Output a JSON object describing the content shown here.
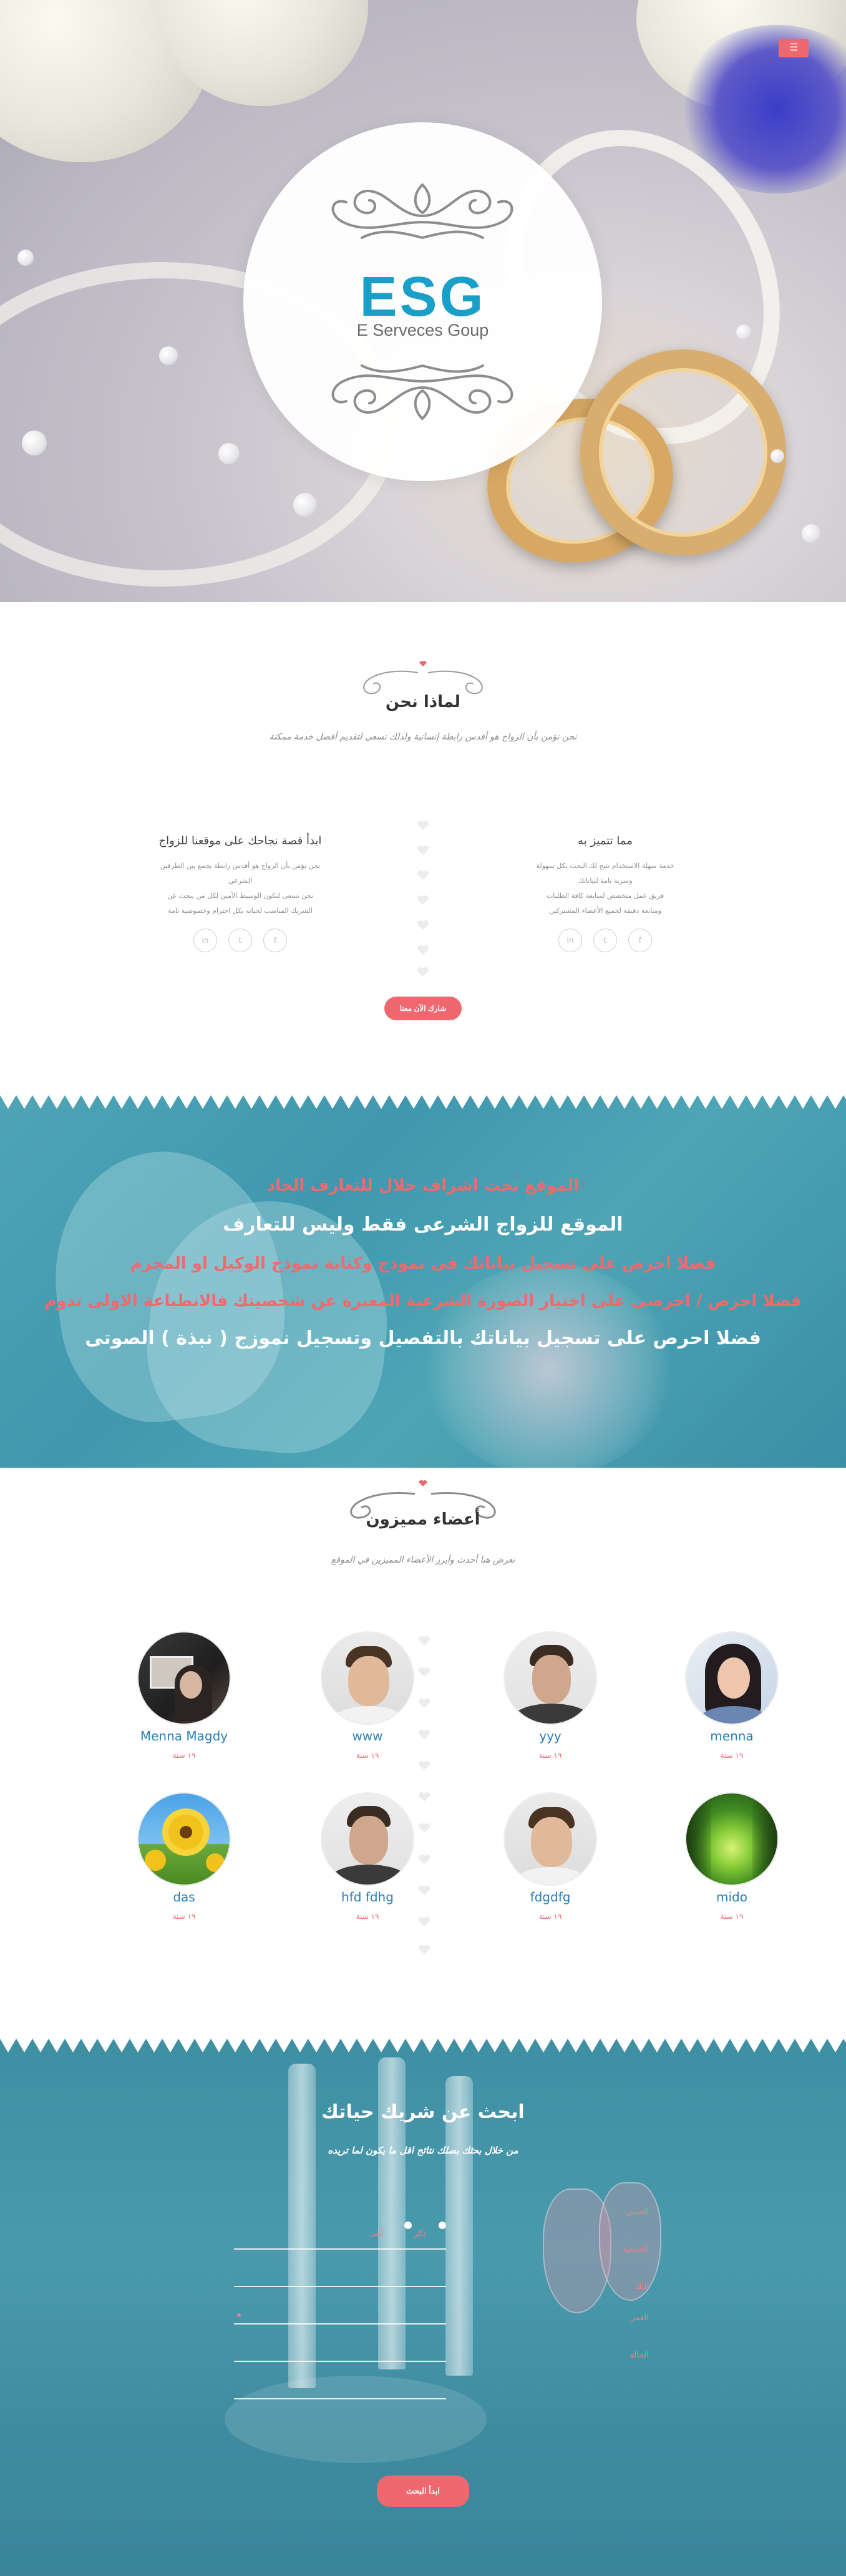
{
  "hero": {
    "menu_icon": "hamburger-menu-icon",
    "logo_title": "ESG",
    "logo_subtitle": "E Serveces Goup"
  },
  "why": {
    "title": "لماذا نحن",
    "subtitle": "نحن نؤمن بأن الزواج هو أقدس رابطة إنسانية ولذلك نسعى لتقديم أفضل خدمة ممكنة",
    "left_feature": {
      "title": "ابدأ قصة نجاحك على موقعنا للزواج",
      "lines": [
        "نحن نؤمن بأن الزواج هو أقدس رابطة يجمع بين الطرفين",
        "الشرعي",
        "نحن نسعى لنكون الوسيط الأمين لكل من يبحث عن",
        "الشريك المناسب لحياته بكل احترام وخصوصية تامة"
      ]
    },
    "right_feature": {
      "title": "مما تتميز به",
      "lines": [
        "خدمة سهلة الاستخدام تتيح لك البحث بكل سهولة",
        "وسرية تامة لبياناتك",
        "فريق عمل متخصص لمتابعة كافة الطلبات",
        "ومتابعة دقيقة لجميع الأعضاء المشتركين"
      ]
    },
    "social_icons": [
      "linkedin-icon",
      "twitter-icon",
      "facebook-icon"
    ],
    "cta_label": "شارك الآن معنا"
  },
  "banner": {
    "lines": [
      "الموقع تحت اشراف حلال للتعارف الجاد",
      "الموقع للزواج الشرعى فقط وليس للتعارف",
      "فضلا احرص على تسجيل بياناتك فى نموذج وكتابة نموذج الوكيل او المحرم",
      "فضلا احرص / احرصي على اختيار الصورة الشرعية المعبرة عن شخصيتك فالانطباعة الاولى تدوم",
      "فضلا احرص على تسجيل بياناتك بالتفصيل وتسجيل نموزج ( نبذة ) الصوتى"
    ]
  },
  "members": {
    "title": "أعضاء مميزون",
    "subtitle": "نعرض هنا أحدث وأبرز الأعضاء المميزين في الموقع",
    "age_label": "١٩ سنة",
    "list": [
      {
        "name": "Menna Magdy",
        "age": "١٩ سنة"
      },
      {
        "name": "www",
        "age": "١٩ سنة"
      },
      {
        "name": "yyy",
        "age": "١٩ سنة"
      },
      {
        "name": "menna",
        "age": "١٩ سنة"
      },
      {
        "name": "das",
        "age": "١٩ سنة"
      },
      {
        "name": "hfd fdhg",
        "age": "١٩ سنة"
      },
      {
        "name": "fdgdfg",
        "age": "١٩ سنة"
      },
      {
        "name": "mido",
        "age": "١٩ سنة"
      }
    ]
  },
  "search": {
    "title": "ابحث عن شريك حياتك",
    "subtitle": "من خلال بحثك بصلك نتائج اقل ما يكون لما تريده",
    "gender_female": "أنثى",
    "gender_male": "ذكر",
    "field_labels": [
      "الجنس",
      "الجنسية",
      "البلد",
      "العمر",
      "الحالة"
    ],
    "submit_label": "ابدأ البحث"
  },
  "colors": {
    "accent": "#f0686f",
    "teal": "#3f98ae",
    "name_blue": "#2a7fb5"
  }
}
